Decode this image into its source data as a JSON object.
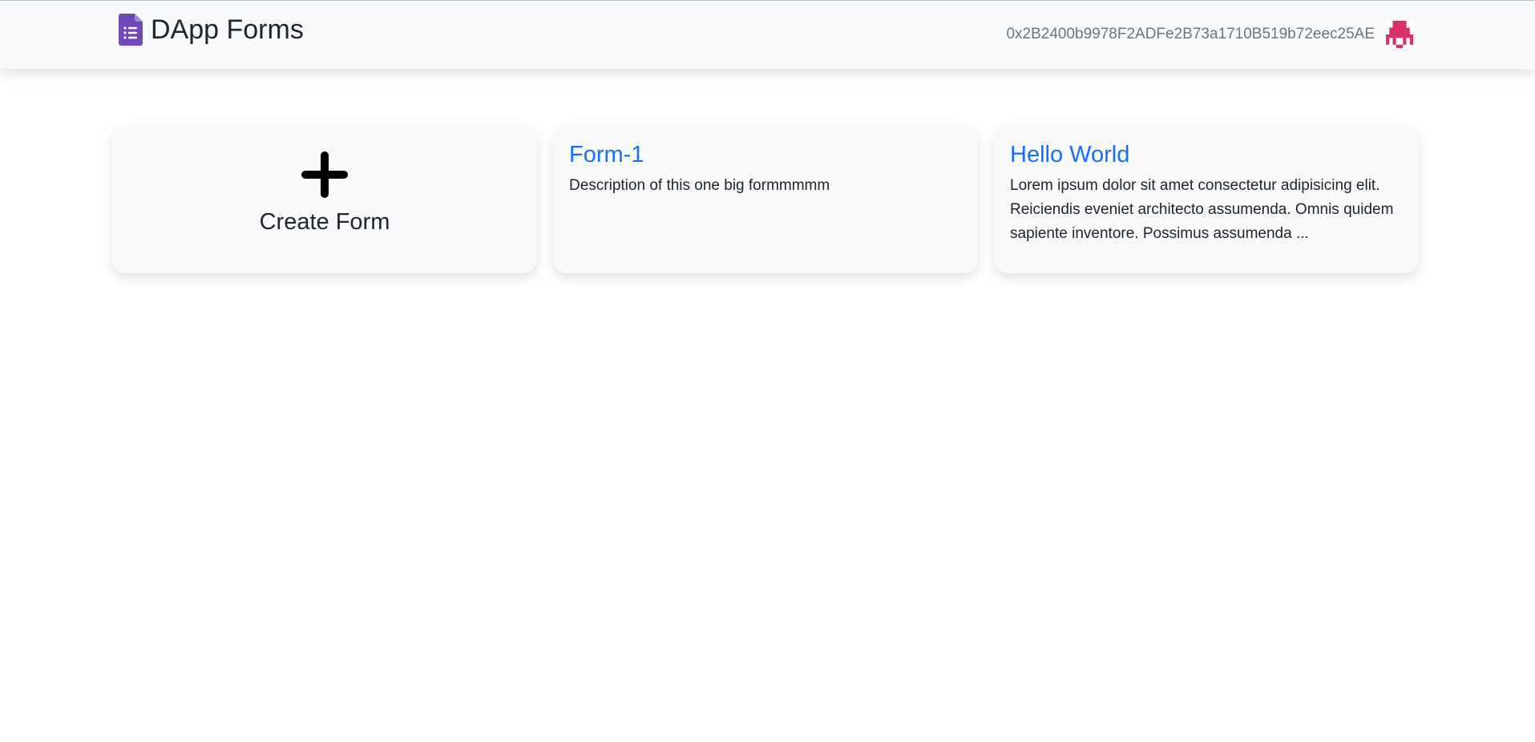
{
  "navbar": {
    "brand": {
      "icon": "google-forms-icon",
      "title": "DApp Forms",
      "icon_color": "#7248b9"
    },
    "account": {
      "address": "0x2B2400b9978F2ADFe2B73a1710B519b72eec25AE",
      "avatar_icon": "identicon-avatar",
      "avatar_color": "#d6316b"
    }
  },
  "cards": {
    "create": {
      "icon": "plus-icon",
      "label": "Create Form"
    },
    "forms": [
      {
        "title": "Form-1",
        "description": "Description of this one big formmmmm"
      },
      {
        "title": "Hello World",
        "description": "Lorem ipsum dolor sit amet consectetur adipisicing elit. Reiciendis eveniet architecto assumenda. Omnis quidem sapiente inventore. Possimus assumenda ..."
      }
    ]
  },
  "colors": {
    "link": "#1a6ef5",
    "navbar_bg": "#f8f9fa",
    "card_bg": "#f8f9fa",
    "muted_text": "#6c757d"
  }
}
